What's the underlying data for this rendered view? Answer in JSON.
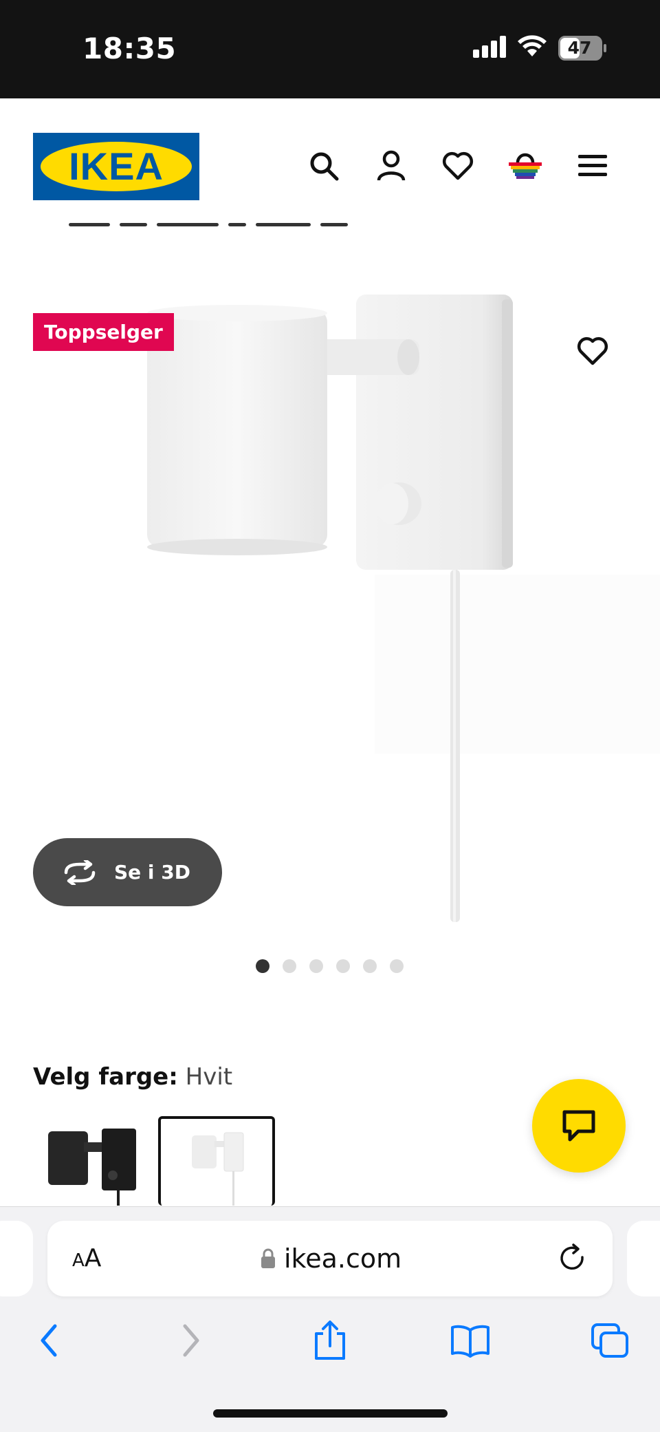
{
  "status_bar": {
    "time": "18:35",
    "battery": "47",
    "icons": [
      "signal-icon",
      "wifi-icon",
      "battery-icon"
    ]
  },
  "header": {
    "logo_text": "IKEA",
    "icons": [
      "search-icon",
      "account-icon",
      "heart-icon",
      "basket-icon",
      "menu-icon"
    ],
    "colors": {
      "logo_blue": "#0058a3",
      "logo_yellow": "#ffdb00"
    }
  },
  "product": {
    "badge": "Toppselger",
    "badge_color": "#e00751",
    "view_3d_label": "Se i 3D",
    "image_count": 6,
    "active_image_index": 1
  },
  "color_selector": {
    "label": "Velg farge:",
    "selected_value": "Hvit",
    "swatches": [
      {
        "name": "black-variant",
        "selected": false
      },
      {
        "name": "white-variant",
        "selected": true
      }
    ]
  },
  "chat": {
    "icon": "chat-icon",
    "color": "#ffdb00"
  },
  "browser": {
    "text_size_small": "A",
    "text_size_big": "A",
    "url": "ikea.com",
    "nav_icons": [
      "back-icon",
      "forward-icon",
      "share-icon",
      "bookmarks-icon",
      "tabs-icon"
    ],
    "accent": "#0a7aff"
  }
}
